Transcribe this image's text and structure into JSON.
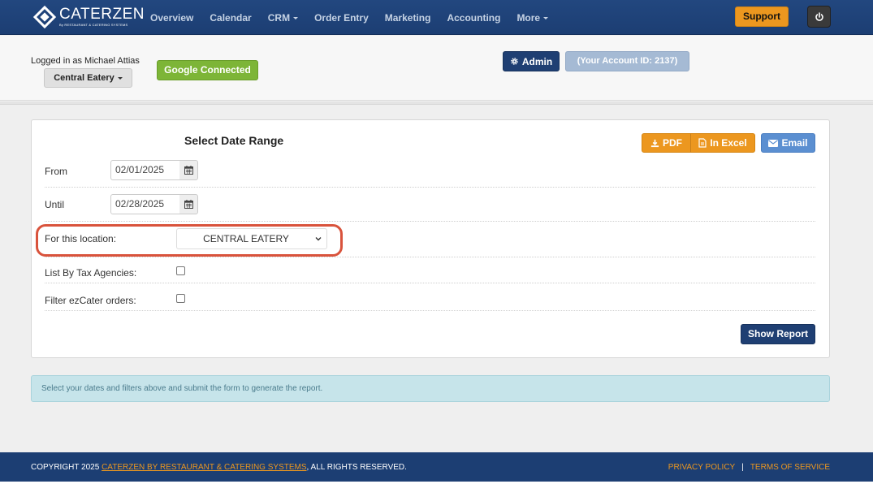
{
  "brand": {
    "name": "CATERZEN",
    "tagline": "By RESTAURANT & CATERING SYSTEMS"
  },
  "nav": {
    "items": [
      {
        "label": "Overview",
        "dropdown": false
      },
      {
        "label": "Calendar",
        "dropdown": false
      },
      {
        "label": "CRM",
        "dropdown": true
      },
      {
        "label": "Order Entry",
        "dropdown": false
      },
      {
        "label": "Marketing",
        "dropdown": false
      },
      {
        "label": "Accounting",
        "dropdown": false
      },
      {
        "label": "More",
        "dropdown": true
      }
    ],
    "support_label": "Support",
    "power_icon": "power-icon"
  },
  "header": {
    "logged_in": "Logged in as Michael Attias",
    "location": "Central Eatery",
    "google": "Google Connected",
    "admin": "Admin",
    "account_id": "(Your Account ID: 2137)"
  },
  "report": {
    "title": "Select Date Range",
    "pdf_label": "PDF",
    "excel_label": "In Excel",
    "email_label": "Email",
    "from_label": "From",
    "from_value": "02/01/2025",
    "until_label": "Until",
    "until_value": "02/28/2025",
    "location_label": "For this location:",
    "location_value": "CENTRAL EATERY",
    "tax_label": "List By Tax Agencies:",
    "tax_checked": false,
    "ezcater_label": "Filter ezCater orders:",
    "ezcater_checked": false,
    "show_report": "Show Report"
  },
  "info": "Select your dates and filters above and submit the form to generate the report.",
  "footer": {
    "copyright_prefix": "COPYRIGHT 2025 ",
    "copyright_link": "CATERZEN BY RESTAURANT & CATERING SYSTEMS",
    "copyright_suffix": ", ALL RIGHTS RESERVED.",
    "privacy": "PRIVACY POLICY",
    "separator": "|",
    "terms": "TERMS OF SERVICE"
  },
  "colors": {
    "nav_bg": "#1f4178",
    "orange": "#ec971f",
    "green": "#7db537",
    "navy_btn": "#1f3f73",
    "email_blue": "#5b8fd1",
    "highlight": "#d9533c",
    "info_bg": "#c6e4ea"
  }
}
